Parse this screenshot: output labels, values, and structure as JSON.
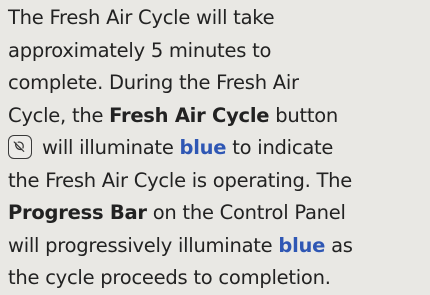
{
  "paragraph": {
    "line1": "The Fresh Air Cycle will take",
    "line2": "approximately 5 minutes to",
    "line3": "complete. During the Fresh Air",
    "line4_pre": "Cycle, the ",
    "line4_bold": "Fresh Air Cycle",
    "line4_post": " button",
    "line5_pre": " will illuminate ",
    "line5_accent": "blue",
    "line5_post": " to indicate",
    "line6": "the Fresh Air Cycle is operating. The",
    "line7_bold": "Progress Bar",
    "line7_post": " on the Control Panel",
    "line8_pre": "will progressively illuminate ",
    "line8_accent": "blue",
    "line8_post": " as",
    "line9": "the cycle proceeds to completion."
  },
  "icons": {
    "fresh_air_cycle_button": "fresh-air-cycle-icon"
  },
  "colors": {
    "background": "#e9e8e4",
    "text": "#222222",
    "accent_blue": "#2f57b4"
  }
}
